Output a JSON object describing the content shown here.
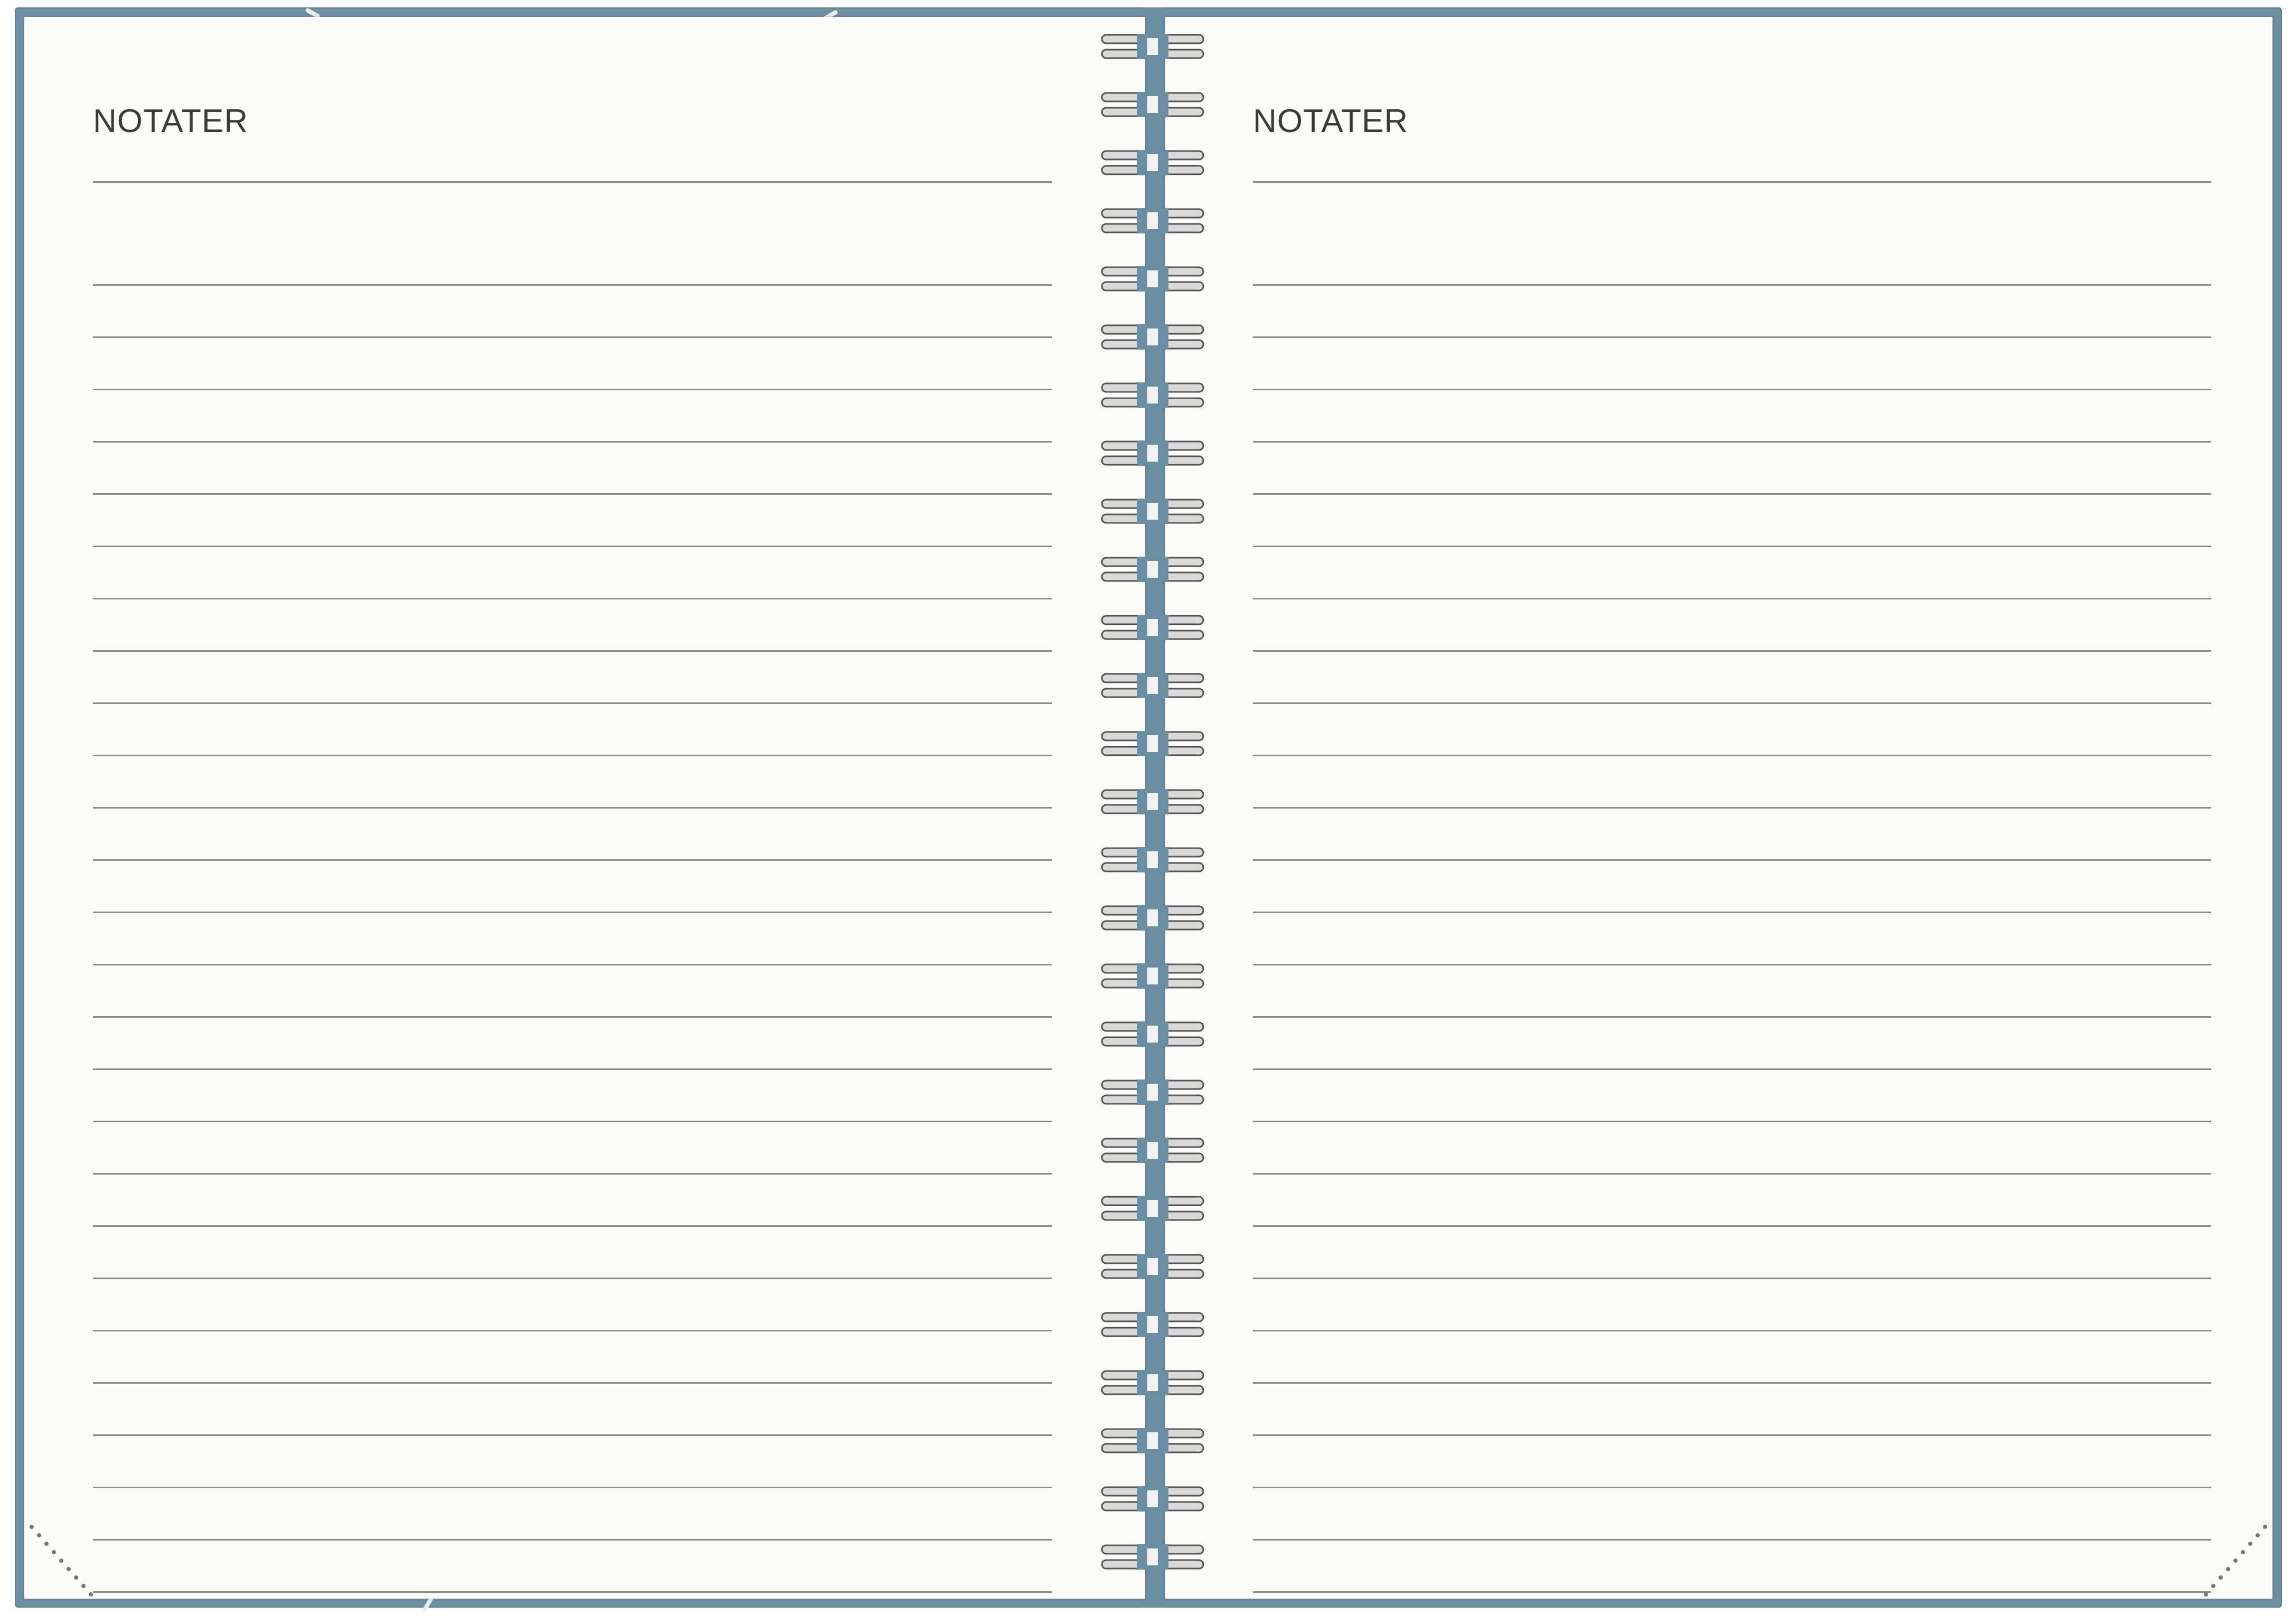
{
  "spread": {
    "left_page": {
      "title": "NOTATER"
    },
    "right_page": {
      "title": "NOTATER"
    }
  },
  "colors": {
    "cover": "#6f8fa3",
    "paper": "#fbfbfa",
    "rule": "#8a8a8a",
    "title_text": "#3b3b3b"
  },
  "icons": [
    "spiral-binding-icon",
    "corner-pocket-icon"
  ]
}
